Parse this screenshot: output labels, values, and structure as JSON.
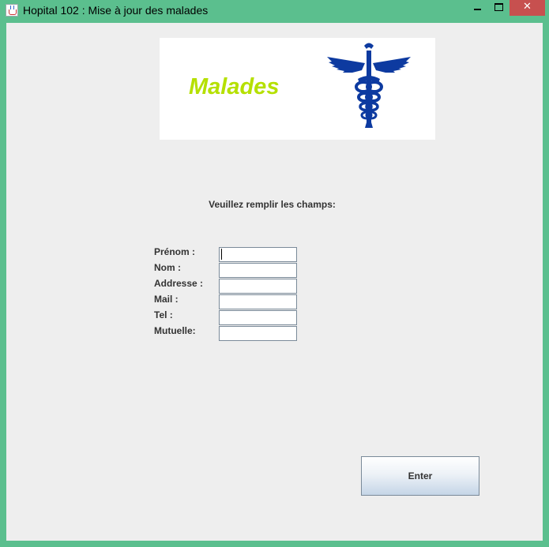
{
  "window": {
    "title": "Hopital 102 : Mise à jour des malades",
    "icon": "java-cup-icon",
    "controls": {
      "minimize": "minimize-icon",
      "maximize": "maximize-icon",
      "close": "close-icon",
      "close_glyph": "✕"
    },
    "frame_color": "#5bbf8e",
    "close_color": "#c7504f"
  },
  "banner": {
    "text": "Malades",
    "text_color": "#b5e000",
    "icon": "caduceus-icon",
    "icon_color": "#0d3aa0"
  },
  "form": {
    "prompt": "Veuillez remplir les champs:",
    "fields": [
      {
        "label": "Prénom :",
        "value": ""
      },
      {
        "label": "Nom :",
        "value": ""
      },
      {
        "label": "Addresse :",
        "value": ""
      },
      {
        "label": "Mail :",
        "value": ""
      },
      {
        "label": "Tel :",
        "value": ""
      },
      {
        "label": "Mutuelle:",
        "value": ""
      }
    ],
    "submit_label": "Enter"
  }
}
